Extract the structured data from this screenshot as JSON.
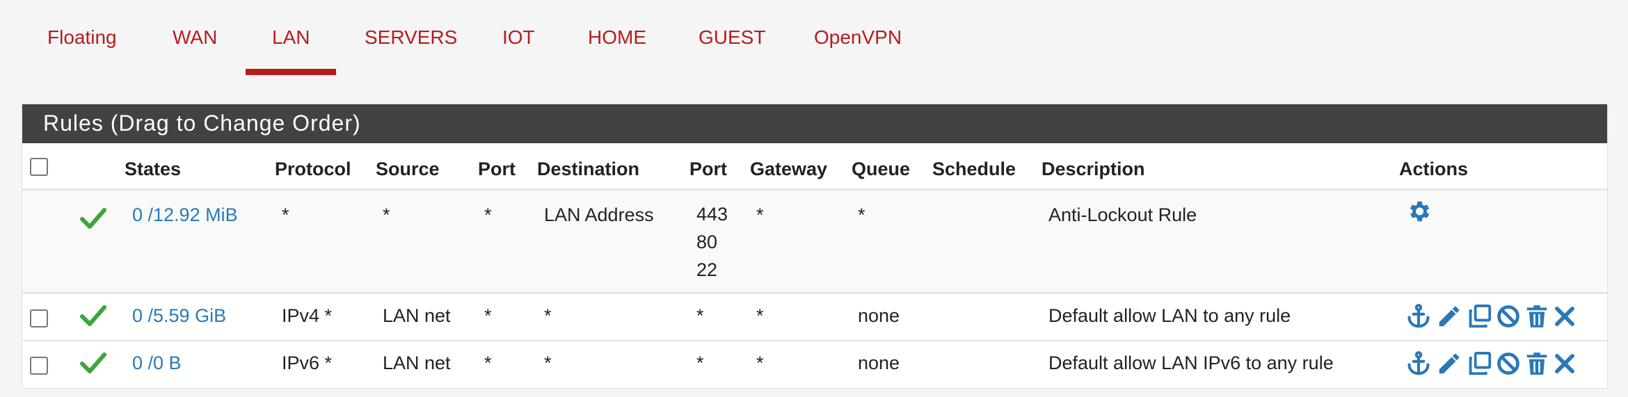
{
  "tabs": [
    "Floating",
    "WAN",
    "LAN",
    "SERVERS",
    "IOT",
    "HOME",
    "GUEST",
    "OpenVPN"
  ],
  "active_tab": "LAN",
  "panel": {
    "title": "Rules (Drag to Change Order)"
  },
  "columns": [
    "States",
    "Protocol",
    "Source",
    "Port",
    "Destination",
    "Port",
    "Gateway",
    "Queue",
    "Schedule",
    "Description",
    "Actions"
  ],
  "rows": [
    {
      "states": "0 /12.92 MiB",
      "protocol": "*",
      "source": "*",
      "port": "*",
      "destination": "LAN Address",
      "dest_port": "443\n80\n22",
      "gateway": "*",
      "queue": "*",
      "schedule": "",
      "description": "Anti-Lockout Rule"
    },
    {
      "states": "0 /5.59 GiB",
      "protocol": "IPv4 *",
      "source": "LAN net",
      "port": "*",
      "destination": "*",
      "dest_port": "*",
      "gateway": "*",
      "queue": "none",
      "schedule": "",
      "description": "Default allow LAN to any rule"
    },
    {
      "states": "0 /0 B",
      "protocol": "IPv6 *",
      "source": "LAN net",
      "port": "*",
      "destination": "*",
      "dest_port": "*",
      "gateway": "*",
      "queue": "none",
      "schedule": "",
      "description": "Default allow LAN IPv6 to any rule"
    }
  ],
  "colors": {
    "accent": "#b71c1c",
    "header_bg": "#424242",
    "link": "#2a78b8",
    "pass": "#3ca53c"
  },
  "icons": {
    "pass": "check-icon",
    "settings": "gear-icon",
    "anchor": "anchor-icon",
    "edit": "pencil-icon",
    "copy": "copy-icon",
    "disable": "ban-icon",
    "delete": "trash-icon",
    "remove": "times-icon"
  }
}
